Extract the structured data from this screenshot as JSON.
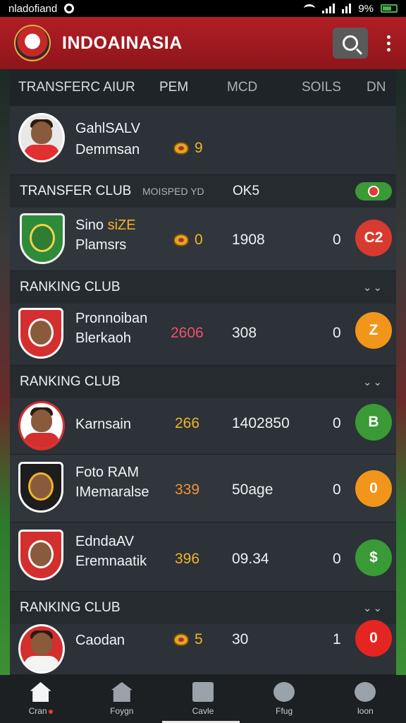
{
  "status_bar": {
    "left_text": "nladofiand",
    "battery": "9%"
  },
  "app_bar": {
    "title": "INDOAINASIA"
  },
  "columns": [
    "TRANSFERC AIUR",
    "PEM",
    "MCD",
    "SOILS",
    "DN"
  ],
  "rows": {
    "r1": {
      "name1": "GahlSALV",
      "name2": "Demmsan",
      "metric1": "9"
    },
    "transfer_head": {
      "title": "TRANSFER CLUB",
      "sub1": "MOISPED YD",
      "sub2": "OK5"
    },
    "r2": {
      "name1a": "Sino ",
      "name1b": "siZE",
      "name2": "Plamsrs",
      "metric1": "0",
      "metric2": "1908",
      "metric3": "0",
      "badge": "C2"
    },
    "rank_head_1": {
      "title": "RANKING CLUB"
    },
    "r3": {
      "name1": "Pronnoiban",
      "name2": "Blerkaoh",
      "metric1": "2606",
      "metric2": "308",
      "metric3": "0",
      "badge": "Z"
    },
    "rank_head_2": {
      "title": "RANKING CLUB"
    },
    "r4": {
      "name1": "Karnsain",
      "metric1": "266",
      "metric2": "1402850",
      "metric3": "0",
      "badge": "B"
    },
    "r5": {
      "name1": "Foto RAM",
      "name2": "IMemaralse",
      "metric1": "339",
      "metric2": "50age",
      "metric3": "0",
      "badge": "0"
    },
    "r6": {
      "name1": "EdndaAV",
      "name2": "Eremnaatik",
      "metric1": "396",
      "metric2": "09.34",
      "metric3": "0",
      "badge": "$"
    },
    "rank_head_3": {
      "title": "RANKING CLUB"
    },
    "r7": {
      "name1": "Caodan",
      "metric1": "5",
      "metric2": "30",
      "metric3": "1",
      "badge": "0"
    }
  },
  "bottom_nav": [
    "Cran",
    "Foygn",
    "Cavle",
    "Ffug",
    "loon"
  ],
  "colors": {
    "app_bar": "#b21e25",
    "gold": "#f0b429",
    "green_badge": "#3a9a35",
    "orange_badge": "#f2951b",
    "red_badge": "#d93a30"
  }
}
